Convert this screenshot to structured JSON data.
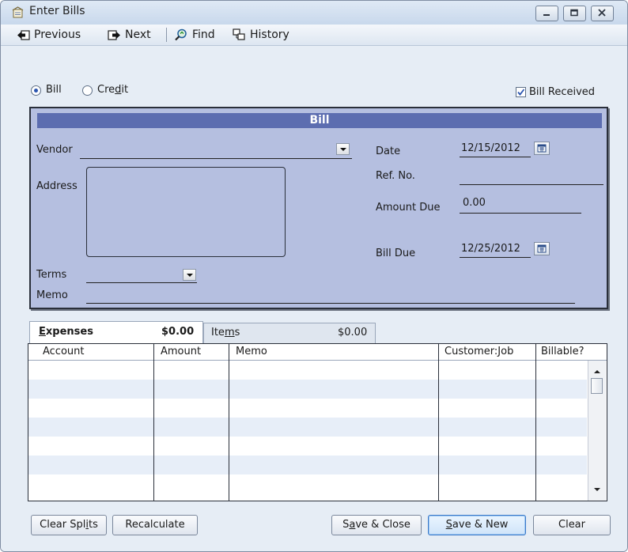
{
  "window": {
    "title": "Enter Bills",
    "controls": [
      "minimize",
      "maximize",
      "close"
    ]
  },
  "toolbar": {
    "previous": "Previous",
    "next": "Next",
    "find": "Find",
    "history": "History"
  },
  "bill_type": {
    "bill_label": "Bill",
    "credit_label_pre": "Cre",
    "credit_label_u": "d",
    "credit_label_post": "it",
    "selected": "Bill"
  },
  "bill_received": {
    "label": "Bill Received",
    "checked": true
  },
  "form": {
    "header": "Bill",
    "vendor_label": "Vendor",
    "vendor_value": "",
    "address_label": "Address",
    "address_value": "",
    "terms_label": "Terms",
    "terms_value": "",
    "memo_label": "Memo",
    "memo_value": "",
    "date_label": "Date",
    "date_value": "12/15/2012",
    "ref_label": "Ref. No.",
    "ref_value": "",
    "amount_due_label": "Amount Due",
    "amount_due_value": "0.00",
    "bill_due_label": "Bill Due",
    "bill_due_value": "12/25/2012"
  },
  "tabs": [
    {
      "label": "Expenses",
      "amount": "$0.00",
      "active": true
    },
    {
      "label_pre": "Ite",
      "label_u": "m",
      "label_post": "s",
      "amount": "$0.00",
      "active": false
    }
  ],
  "grid": {
    "columns": [
      "Account",
      "Amount",
      "Memo",
      "Customer:Job",
      "Billable?"
    ],
    "rows": 7
  },
  "buttons": {
    "clear_splits_pre": "Clear Spl",
    "clear_splits_u": "i",
    "clear_splits_post": "ts",
    "recalculate": "Recalculate",
    "save_close_pre": "S",
    "save_close_u": "a",
    "save_close_post": "ve & Close",
    "save_new_u": "S",
    "save_new_post": "ave & New",
    "clear": "Clear"
  }
}
